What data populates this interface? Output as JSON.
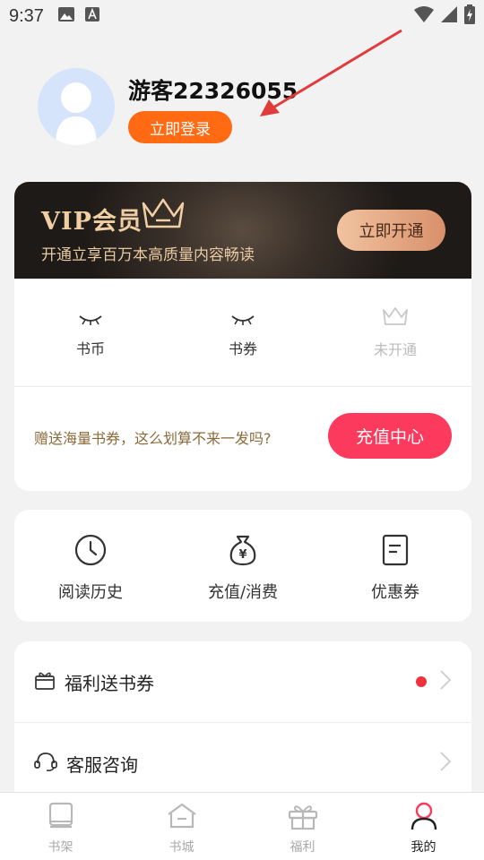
{
  "status_bar": {
    "time": "9:37"
  },
  "profile": {
    "username": "游客22326055",
    "login_label": "立即登录"
  },
  "vip": {
    "title": "VIP会员",
    "subtitle": "开通立享百万本高质量内容畅读",
    "open_label": "立即开通",
    "stats": [
      {
        "label": "书币",
        "icon": "closed-eye-icon"
      },
      {
        "label": "书券",
        "icon": "closed-eye-icon"
      },
      {
        "label": "未开通",
        "icon": "crown-icon"
      }
    ],
    "promo_text": "赠送海量书券，这么划算不来一发吗?",
    "recharge_center_label": "充值中心",
    "colors": {
      "gold": "#f0cfa4",
      "recharge": "#fb3a5d"
    }
  },
  "quick_actions": [
    {
      "label": "阅读历史",
      "icon": "clock-icon"
    },
    {
      "label": "充值/消费",
      "icon": "money-bag-icon"
    },
    {
      "label": "优惠券",
      "icon": "coupon-icon"
    }
  ],
  "menu": [
    {
      "label": "福利送书券",
      "icon": "gift-box-icon"
    },
    {
      "label": "客服咨询",
      "icon": "headset-icon"
    }
  ],
  "tabs": [
    {
      "label": "书架",
      "icon": "bookshelf-icon"
    },
    {
      "label": "书城",
      "icon": "bookstore-icon"
    },
    {
      "label": "福利",
      "icon": "gift-icon"
    },
    {
      "label": "我的",
      "icon": "profile-icon"
    }
  ],
  "accent_color": "#ff6a13"
}
